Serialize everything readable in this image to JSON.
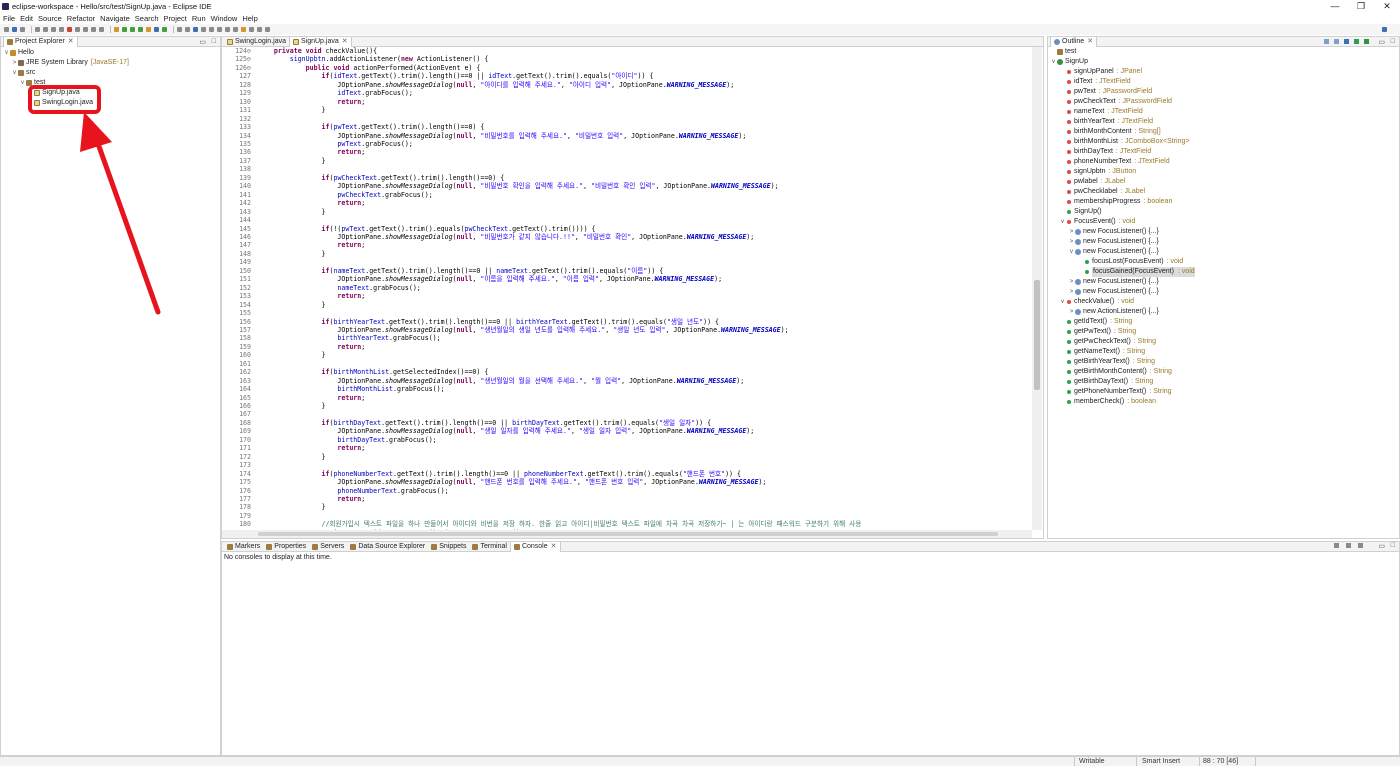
{
  "window": {
    "title": "eclipse-workspace - Hello/src/test/SignUp.java - Eclipse IDE",
    "controls": {
      "minimize": "—",
      "maximize": "❐",
      "close": "✕"
    }
  },
  "menu": [
    "File",
    "Edit",
    "Source",
    "Refactor",
    "Navigate",
    "Search",
    "Project",
    "Run",
    "Window",
    "Help"
  ],
  "project_explorer": {
    "tab_label": "Project Explorer",
    "items": [
      {
        "label": "Hello",
        "depth": 0,
        "caret": "v",
        "icon": "project-icon"
      },
      {
        "label": "JRE System Library",
        "suffix": "[JavaSE-17]",
        "depth": 1,
        "caret": ">",
        "icon": "library-icon"
      },
      {
        "label": "src",
        "depth": 1,
        "caret": "v",
        "icon": "package-folder-icon"
      },
      {
        "label": "test",
        "depth": 2,
        "caret": "v",
        "icon": "package-icon"
      },
      {
        "label": "SignUp.java",
        "depth": 3,
        "caret": "",
        "icon": "java-file-icon"
      },
      {
        "label": "SwingLogin.java",
        "depth": 3,
        "caret": "",
        "icon": "java-file-icon"
      }
    ]
  },
  "editor": {
    "tabs": [
      {
        "label": "SwingLogin.java",
        "active": false
      },
      {
        "label": "SignUp.java",
        "active": true
      }
    ],
    "line_numbers": [
      "124⊖",
      "125⊖",
      "126⊖",
      "127",
      "128",
      "129",
      "130",
      "131",
      "132",
      "133",
      "134",
      "135",
      "136",
      "137",
      "138",
      "139",
      "140",
      "141",
      "142",
      "143",
      "144",
      "145",
      "146",
      "147",
      "148",
      "149",
      "150",
      "151",
      "152",
      "153",
      "154",
      "155",
      "156",
      "157",
      "158",
      "159",
      "160",
      "161",
      "162",
      "163",
      "164",
      "165",
      "166",
      "167",
      "168",
      "169",
      "170",
      "171",
      "172",
      "173",
      "174",
      "175",
      "176",
      "177",
      "178",
      "179",
      "180",
      "181"
    ]
  },
  "bottom_panel": {
    "tabs": [
      "Markers",
      "Properties",
      "Servers",
      "Data Source Explorer",
      "Snippets",
      "Terminal",
      "Console"
    ],
    "active_tab": "Console",
    "message": "No consoles to display at this time."
  },
  "outline": {
    "tab_label": "Outline",
    "items": [
      {
        "label": "test",
        "depth": 0,
        "caret": "",
        "icon": "package-icon",
        "type": ""
      },
      {
        "label": "SignUp",
        "depth": 0,
        "caret": "v",
        "icon": "class-icon",
        "type": ""
      },
      {
        "label": "signUpPanel",
        "depth": 1,
        "caret": "",
        "icon": "private-field-icon",
        "type": ": JPanel"
      },
      {
        "label": "idText",
        "depth": 1,
        "caret": "",
        "icon": "private-field-icon",
        "type": ": JTextField"
      },
      {
        "label": "pwText",
        "depth": 1,
        "caret": "",
        "icon": "private-field-icon",
        "type": ": JPasswordField"
      },
      {
        "label": "pwCheckText",
        "depth": 1,
        "caret": "",
        "icon": "private-field-icon",
        "type": ": JPasswordField"
      },
      {
        "label": "nameText",
        "depth": 1,
        "caret": "",
        "icon": "private-field-icon",
        "type": ": JTextField"
      },
      {
        "label": "birthYearText",
        "depth": 1,
        "caret": "",
        "icon": "private-field-icon",
        "type": ": JTextField"
      },
      {
        "label": "birthMonthContent",
        "depth": 1,
        "caret": "",
        "icon": "private-field-icon",
        "type": ": String[]"
      },
      {
        "label": "birthMonthList",
        "depth": 1,
        "caret": "",
        "icon": "private-field-icon",
        "type": ": JComboBox<String>"
      },
      {
        "label": "birthDayText",
        "depth": 1,
        "caret": "",
        "icon": "private-field-icon",
        "type": ": JTextField"
      },
      {
        "label": "phoneNumberText",
        "depth": 1,
        "caret": "",
        "icon": "private-field-icon",
        "type": ": JTextField"
      },
      {
        "label": "signUpbtn",
        "depth": 1,
        "caret": "",
        "icon": "private-field-icon",
        "type": ": JButton"
      },
      {
        "label": "pwlabel",
        "depth": 1,
        "caret": "",
        "icon": "private-field-icon",
        "type": ": JLabel"
      },
      {
        "label": "pwChecklabel",
        "depth": 1,
        "caret": "",
        "icon": "private-field-icon",
        "type": ": JLabel"
      },
      {
        "label": "membershipProgress",
        "depth": 1,
        "caret": "",
        "icon": "private-field-icon",
        "type": ": boolean"
      },
      {
        "label": "SignUp()",
        "depth": 1,
        "caret": "",
        "icon": "constructor-icon",
        "type": ""
      },
      {
        "label": "FocusEvent()",
        "depth": 1,
        "caret": "v",
        "icon": "private-method-icon",
        "type": ": void"
      },
      {
        "label": "new FocusListener() {...}",
        "depth": 2,
        "caret": ">",
        "icon": "anonymous-class-icon",
        "type": ""
      },
      {
        "label": "new FocusListener() {...}",
        "depth": 2,
        "caret": ">",
        "icon": "anonymous-class-icon",
        "type": ""
      },
      {
        "label": "new FocusListener() {...}",
        "depth": 2,
        "caret": "v",
        "icon": "anonymous-class-icon",
        "type": ""
      },
      {
        "label": "focusLost(FocusEvent)",
        "depth": 3,
        "caret": "",
        "icon": "public-method-icon",
        "type": ": void"
      },
      {
        "label": "focusGained(FocusEvent)",
        "depth": 3,
        "caret": "",
        "icon": "public-method-icon",
        "type": ": void",
        "selected": true
      },
      {
        "label": "new FocusListener() {...}",
        "depth": 2,
        "caret": ">",
        "icon": "anonymous-class-icon",
        "type": ""
      },
      {
        "label": "new FocusListener() {...}",
        "depth": 2,
        "caret": ">",
        "icon": "anonymous-class-icon",
        "type": ""
      },
      {
        "label": "checkValue()",
        "depth": 1,
        "caret": "v",
        "icon": "private-method-icon",
        "type": ": void"
      },
      {
        "label": "new ActionListener() {...}",
        "depth": 2,
        "caret": ">",
        "icon": "anonymous-class-icon",
        "type": ""
      },
      {
        "label": "getIdText()",
        "depth": 1,
        "caret": "",
        "icon": "public-method-icon",
        "type": ": String"
      },
      {
        "label": "getPwText()",
        "depth": 1,
        "caret": "",
        "icon": "public-method-icon",
        "type": ": String"
      },
      {
        "label": "getPwCheckText()",
        "depth": 1,
        "caret": "",
        "icon": "public-method-icon",
        "type": ": String"
      },
      {
        "label": "getNameText()",
        "depth": 1,
        "caret": "",
        "icon": "public-method-icon",
        "type": ": String"
      },
      {
        "label": "getBirthYearText()",
        "depth": 1,
        "caret": "",
        "icon": "public-method-icon",
        "type": ": String"
      },
      {
        "label": "getBirthMonthContent()",
        "depth": 1,
        "caret": "",
        "icon": "public-method-icon",
        "type": ": String"
      },
      {
        "label": "getBirthDayText()",
        "depth": 1,
        "caret": "",
        "icon": "public-method-icon",
        "type": ": String"
      },
      {
        "label": "getPhoneNumberText()",
        "depth": 1,
        "caret": "",
        "icon": "public-method-icon",
        "type": ": String"
      },
      {
        "label": "memberCheck()",
        "depth": 1,
        "caret": "",
        "icon": "public-method-icon",
        "type": ": boolean"
      }
    ]
  },
  "status": {
    "writable": "Writable",
    "insert_mode": "Smart Insert",
    "cursor": "88 : 70 [46]"
  },
  "annotation": {
    "color": "#e8141d"
  }
}
